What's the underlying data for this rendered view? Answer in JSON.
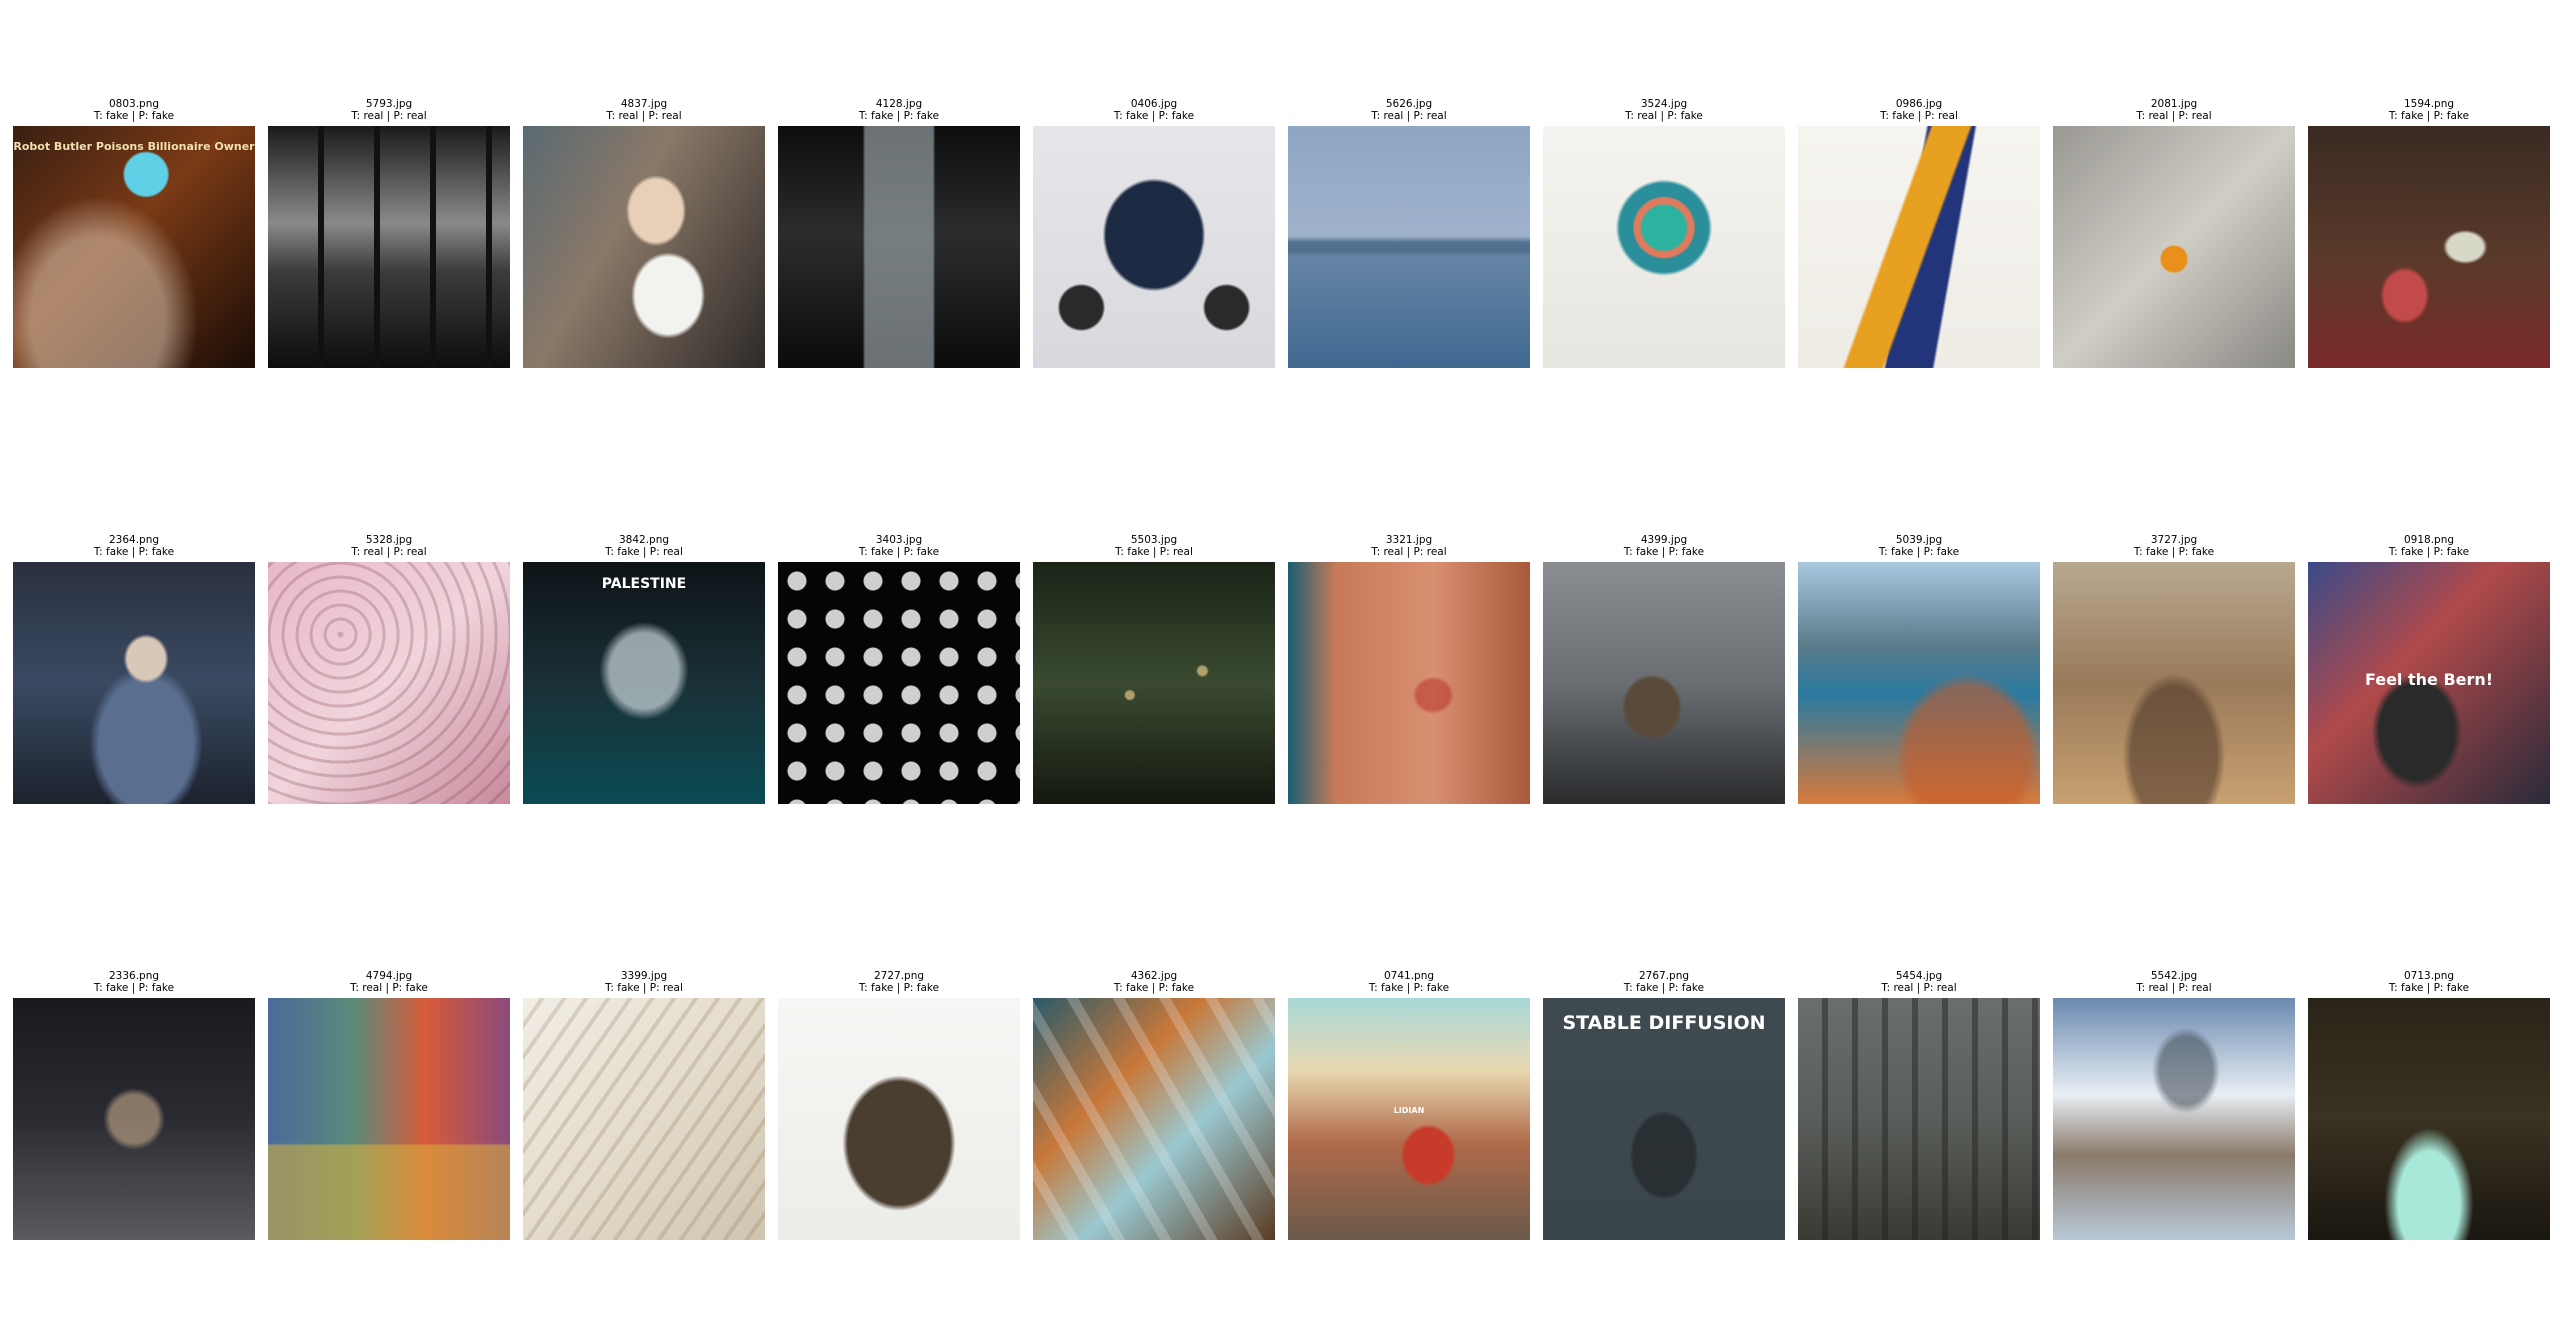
{
  "grid": {
    "rows": [
      [
        {
          "filename": "0803.png",
          "label": "T: fake | P: fake",
          "thumb": {
            "bg": "linear-gradient(135deg,#3a1f12 0%,#7a3a16 45%,#1a0c06 100%)",
            "overlay": "radial-gradient(circle at 55% 20%, #5fd0e6 0 9%, transparent 10%), radial-gradient(ellipse at 35% 80%, rgba(220,200,180,0.55) 0 30%, transparent 45%)",
            "text": "Robot Butler Poisons Billionaire Owner",
            "text_color": "#f0e0b0",
            "text_size": 11,
            "text_pos": "t"
          }
        },
        {
          "filename": "5793.jpg",
          "label": "T: real | P: real",
          "thumb": {
            "bg": "linear-gradient(180deg,#1a1a1a 0%,#8a8a8a 40%,#3c3c3c 60%,#0d0d0d 100%)",
            "overlay": "repeating-linear-gradient(90deg, transparent 0 50px, #111 50px 56px)"
          }
        },
        {
          "filename": "4837.jpg",
          "label": "T: real | P: real",
          "thumb": {
            "bg": "linear-gradient(120deg,#5a6a72 0%,#8a7868 40%,#2e2a28 100%)",
            "overlay": "radial-gradient(ellipse at 55% 35%, #e8d0b8 0 14%, transparent 16%), radial-gradient(ellipse at 60% 70%, #f2f2ee 0 16%, transparent 18%)"
          }
        },
        {
          "filename": "4128.jpg",
          "label": "T: fake | P: fake",
          "thumb": {
            "bg": "linear-gradient(180deg,#0e0e0e 0%,#2a2c2e 45%,#0b0b0b 100%)",
            "overlay": "linear-gradient(90deg, transparent 35%, rgba(170,180,185,0.6) 36% 64%, transparent 65%)"
          }
        },
        {
          "filename": "0406.jpg",
          "label": "T: fake | P: fake",
          "thumb": {
            "bg": "linear-gradient(180deg,#e6e6ea 0%,#d8d8de 100%)",
            "overlay": "radial-gradient(ellipse at 50% 45%, #1d2a44 0 28%, transparent 30%), radial-gradient(circle at 20% 75%, #2a2a2a 0 8%, transparent 9%), radial-gradient(circle at 80% 75%, #2a2a2a 0 8%, transparent 9%)"
          }
        },
        {
          "filename": "5626.jpg",
          "label": "T: real | P: real",
          "thumb": {
            "bg": "linear-gradient(180deg,#8ea6c4 0%,#9fb2cc 45%,#6a88a8 50%,#3f6890 100%)",
            "overlay": "linear-gradient(180deg, transparent 46%, rgba(70,100,130,0.7) 48% 52%, transparent 54%)"
          }
        },
        {
          "filename": "3524.jpg",
          "label": "T: real | P: fake",
          "thumb": {
            "bg": "linear-gradient(180deg,#f4f3ef 0%,#e8e6e0 100%)",
            "overlay": "radial-gradient(circle at 50% 42%, #2bb3a0 0 12%, #e07a5f 13% 16%, #2a8f9a 17% 24%, transparent 26%)"
          }
        },
        {
          "filename": "0986.jpg",
          "label": "T: fake | P: real",
          "thumb": {
            "bg": "linear-gradient(180deg,#f6f4ef 0%,#efece6 100%)",
            "overlay": "linear-gradient(110deg, transparent 40%, #e8a020 41% 52%, transparent 53%), linear-gradient(100deg, transparent 45%, #22357a 46% 62%, transparent 63%)"
          }
        },
        {
          "filename": "2081.jpg",
          "label": "T: real | P: real",
          "thumb": {
            "bg": "linear-gradient(135deg,#9a9892 0%,#cfcdc6 50%,#8a8882 100%)",
            "overlay": "radial-gradient(circle at 50% 55%, #e8901a 0 7%, transparent 8%)"
          }
        },
        {
          "filename": "1594.png",
          "label": "T: fake | P: fake",
          "thumb": {
            "bg": "linear-gradient(180deg,#3a2a22 0%,#5a3a2a 55%,#7a2a28 100%)",
            "overlay": "radial-gradient(ellipse at 40% 70%, #c24a4a 0 10%, transparent 12%), radial-gradient(ellipse at 65% 50%, #d8d8c8 0 8%, transparent 10%)"
          }
        }
      ],
      [
        {
          "filename": "2364.png",
          "label": "T: fake | P: fake",
          "thumb": {
            "bg": "linear-gradient(180deg,#2a3040 0%,#3a4a62 50%,#1c222e 100%)",
            "overlay": "radial-gradient(ellipse at 55% 40%, #d8c8b8 0 10%, transparent 12%), radial-gradient(ellipse at 55% 75%, #5a6f90 0 25%, transparent 30%)"
          }
        },
        {
          "filename": "5328.jpg",
          "label": "T: real | P: real",
          "thumb": {
            "bg": "linear-gradient(135deg,#e8b8c8 0%,#f0d4dc 50%,#c88a9c 100%)",
            "overlay": "repeating-radial-gradient(circle at 30% 30%, rgba(120,60,70,0.25) 0 3px, transparent 3px 14px)"
          }
        },
        {
          "filename": "3842.png",
          "label": "T: fake | P: real",
          "thumb": {
            "bg": "linear-gradient(180deg,#0e1418 0%,#1a3036 50%,#0a4b54 100%)",
            "overlay": "radial-gradient(ellipse at 50% 45%, rgba(220,230,235,0.65) 0 20%, transparent 26%)",
            "text": "PALESTINE",
            "text_color": "#ffffff",
            "text_size": 14,
            "text_pos": "t"
          }
        },
        {
          "filename": "3403.jpg",
          "label": "T: fake | P: fake",
          "thumb": {
            "bg": "#050505",
            "overlay": "radial-gradient(circle, #cfcfcf 0 9px, transparent 10px) 0 0/38px 38px"
          }
        },
        {
          "filename": "5503.jpg",
          "label": "T: fake | P: real",
          "thumb": {
            "bg": "linear-gradient(180deg,#1a2418 0%,#3a4a30 50%,#141810 100%)",
            "overlay": "radial-gradient(circle at 40% 55%, rgba(255,220,150,0.6) 0 2%, transparent 3%), radial-gradient(circle at 70% 45%, rgba(255,220,150,0.6) 0 2%, transparent 3%)"
          }
        },
        {
          "filename": "3321.jpg",
          "label": "T: real | P: real",
          "thumb": {
            "bg": "linear-gradient(90deg,#1a5f72 0%,#c87a58 20%,#d89070 60%,#a85a3a 100%)",
            "overlay": "radial-gradient(ellipse at 60% 55%, rgba(180,40,40,0.5) 0 8%, transparent 10%)"
          }
        },
        {
          "filename": "4399.jpg",
          "label": "T: fake | P: fake",
          "thumb": {
            "bg": "linear-gradient(180deg,#8a8e92 0%,#6a6e72 50%,#2a2c2e 100%)",
            "overlay": "radial-gradient(ellipse at 45% 60%, #5a4a3a 0 14%, transparent 16%)"
          }
        },
        {
          "filename": "5039.jpg",
          "label": "T: fake | P: fake",
          "thumb": {
            "bg": "linear-gradient(180deg,#a8c8e0 0%,#5a7a8a 35%,#2a7aa0 55%,#d87a3a 100%)",
            "overlay": "radial-gradient(ellipse at 70% 80%, rgba(200,90,40,0.6) 0 25%, transparent 30%)"
          }
        },
        {
          "filename": "3727.jpg",
          "label": "T: fake | P: fake",
          "thumb": {
            "bg": "linear-gradient(180deg,#b8a890 0%,#9a7a5a 50%,#c8a070 100%)",
            "overlay": "radial-gradient(ellipse at 50% 80%, rgba(60,40,30,0.5) 0 25%, transparent 30%)"
          }
        },
        {
          "filename": "0918.png",
          "label": "T: fake | P: fake",
          "thumb": {
            "bg": "linear-gradient(135deg,#3a4a8a 0%,#b04a4a 40%,#2a2a3a 100%)",
            "overlay": "radial-gradient(ellipse at 45% 70%, #2a2a2a 0 20%, transparent 24%)",
            "text": "Feel the Bern!",
            "text_color": "#ffffff",
            "text_size": 16,
            "text_pos": "m"
          }
        }
      ],
      [
        {
          "filename": "2336.png",
          "label": "T: fake | P: fake",
          "thumb": {
            "bg": "linear-gradient(180deg,#1a1a1e 0%,#2a2c32 50%,#5a5a60 100%)",
            "overlay": "radial-gradient(ellipse at 50% 50%, rgba(200,170,140,0.6) 0 14%, transparent 18%)"
          }
        },
        {
          "filename": "4794.jpg",
          "label": "T: real | P: fake",
          "thumb": {
            "bg": "linear-gradient(90deg,#4a6a9a 0%,#5a8a7a 35%,#d85a3a 65%,#8a4a7a 100%)",
            "overlay": "linear-gradient(180deg, transparent 60%, rgba(220,180,60,0.55) 61% 100%)"
          }
        },
        {
          "filename": "3399.jpg",
          "label": "T: fake | P: real",
          "thumb": {
            "bg": "linear-gradient(135deg,#f2eee6 0%,#e4dccc 50%,#cfc4b0 100%)",
            "overlay": "repeating-linear-gradient(125deg, transparent 0 14px, rgba(140,120,90,0.25) 14px 18px)"
          }
        },
        {
          "filename": "2727.png",
          "label": "T: fake | P: fake",
          "thumb": {
            "bg": "linear-gradient(180deg,#f6f6f4 0%,#ecece8 100%)",
            "overlay": "radial-gradient(ellipse at 50% 60%, #4a3e30 0 30%, transparent 33%)"
          }
        },
        {
          "filename": "4362.jpg",
          "label": "T: fake | P: fake",
          "thumb": {
            "bg": "linear-gradient(135deg,#2a5a6a 0%,#c8783a 35%,#9ac8d0 60%,#5a3a22 100%)",
            "overlay": "repeating-linear-gradient(60deg, transparent 0 30px, rgba(240,240,240,0.25) 30px 40px)"
          }
        },
        {
          "filename": "0741.png",
          "label": "T: fake | P: fake",
          "thumb": {
            "bg": "linear-gradient(180deg,#a8d8d8 0%,#e8d8b0 30%,#b06a4a 60%,#6a5a4a 100%)",
            "overlay": "radial-gradient(ellipse at 58% 65%, #c83a2a 0 12%, transparent 14%)",
            "text": "LIDIAN",
            "text_color": "#ffffff",
            "text_size": 8,
            "text_pos": "m"
          }
        },
        {
          "filename": "2767.png",
          "label": "T: fake | P: fake",
          "thumb": {
            "bg": "linear-gradient(180deg,#3e4a50 0%,#3a464c 100%)",
            "overlay": "radial-gradient(ellipse at 50% 65%, rgba(20,20,20,0.45) 0 18%, transparent 20%)",
            "text": "STABLE DIFFUSION",
            "text_color": "#ffffff",
            "text_size": 19,
            "text_pos": "t"
          }
        },
        {
          "filename": "5454.jpg",
          "label": "T: real | P: real",
          "thumb": {
            "bg": "linear-gradient(180deg,#6a6e6c 0%,#5a5e5a 50%,#3a3a34 100%)",
            "overlay": "repeating-linear-gradient(90deg, transparent 0 24px, rgba(30,30,28,0.45) 24px 30px)"
          }
        },
        {
          "filename": "5542.jpg",
          "label": "T: real | P: real",
          "thumb": {
            "bg": "linear-gradient(180deg,#6a8ab0 0%,#e8eef4 40%,#8a7a6a 65%,#b8c8d8 100%)",
            "overlay": "radial-gradient(ellipse at 55% 30%, rgba(60,70,80,0.55) 0 14%, transparent 18%)"
          }
        },
        {
          "filename": "0713.png",
          "label": "T: fake | P: fake",
          "thumb": {
            "bg": "linear-gradient(180deg,#2a2418 0%,#3a3222 50%,#1a1610 100%)",
            "overlay": "radial-gradient(ellipse at 50% 85%, #a8e8d8 0 18%, transparent 26%)"
          }
        }
      ]
    ]
  }
}
